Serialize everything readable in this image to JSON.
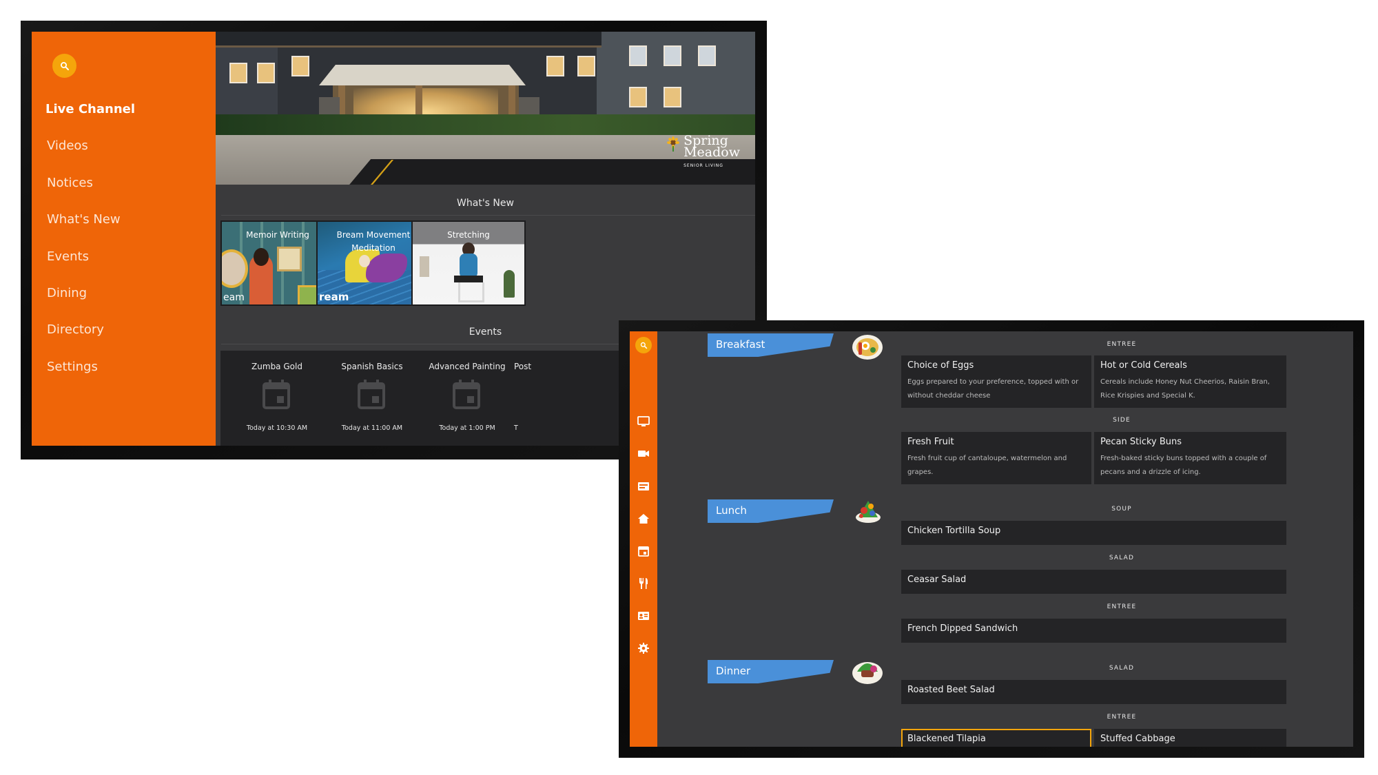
{
  "screen1": {
    "nav": [
      {
        "label": "Live Channel",
        "active": true
      },
      {
        "label": "Videos"
      },
      {
        "label": "Notices"
      },
      {
        "label": "What's New"
      },
      {
        "label": "Events"
      },
      {
        "label": "Dining"
      },
      {
        "label": "Directory"
      },
      {
        "label": "Settings"
      }
    ],
    "logo": {
      "line1": "Spring",
      "line2": "Meadow",
      "line3": "SENIOR LIVING"
    },
    "whats_new": {
      "title": "What's New",
      "items": [
        {
          "label": "Memoir Writing",
          "overlay": "eam"
        },
        {
          "label": "Bream Movement Meditation",
          "overlay": "ream"
        },
        {
          "label": "Stretching"
        }
      ]
    },
    "events": {
      "title": "Events",
      "items": [
        {
          "name": "Zumba Gold",
          "time": "Today at 10:30 AM"
        },
        {
          "name": "Spanish Basics",
          "time": "Today at 11:00 AM"
        },
        {
          "name": "Advanced Painting",
          "time": "Today at 1:00 PM"
        },
        {
          "name": "Post",
          "time": "T"
        }
      ]
    }
  },
  "screen2": {
    "sidebar_icons": [
      "search-icon",
      "tv-icon",
      "video-camera-icon",
      "notice-icon",
      "home-icon",
      "calendar-icon",
      "dining-icon",
      "directory-card-icon",
      "settings-gear-icon"
    ],
    "meals": [
      {
        "label": "Breakfast"
      },
      {
        "label": "Lunch"
      },
      {
        "label": "Dinner"
      }
    ],
    "breakfast": {
      "cat_entree": "ENTREE",
      "eggs": {
        "name": "Choice of Eggs",
        "desc": "Eggs prepared to your preference, topped with or without cheddar cheese"
      },
      "cereals": {
        "name": "Hot or Cold Cereals",
        "desc": "Cereals include Honey Nut Cheerios, Raisin Bran, Rice Krispies and Special K."
      },
      "cat_side": "SIDE",
      "fruit": {
        "name": "Fresh Fruit",
        "desc": "Fresh fruit cup of cantaloupe, watermelon and grapes."
      },
      "buns": {
        "name": "Pecan Sticky Buns",
        "desc": "Fresh-baked sticky buns topped with a couple of pecans and a drizzle of icing."
      }
    },
    "lunch": {
      "cat_soup": "SOUP",
      "soup": {
        "name": "Chicken Tortilla Soup"
      },
      "cat_salad": "SALAD",
      "salad": {
        "name": "Ceasar Salad"
      },
      "cat_entree": "ENTREE",
      "entree": {
        "name": "French Dipped Sandwich"
      }
    },
    "dinner": {
      "cat_salad": "SALAD",
      "salad": {
        "name": "Roasted Beet Salad"
      },
      "cat_entree": "ENTREE",
      "entree1": {
        "name": "Blackened Tilapia"
      },
      "entree2": {
        "name": "Stuffed Cabbage"
      }
    }
  },
  "colors": {
    "accent_orange": "#ef6508",
    "search_yellow": "#f5a50b",
    "meal_blue": "#4a90d9",
    "panel_dark": "#242426",
    "screen_bg": "#3a3a3c"
  }
}
